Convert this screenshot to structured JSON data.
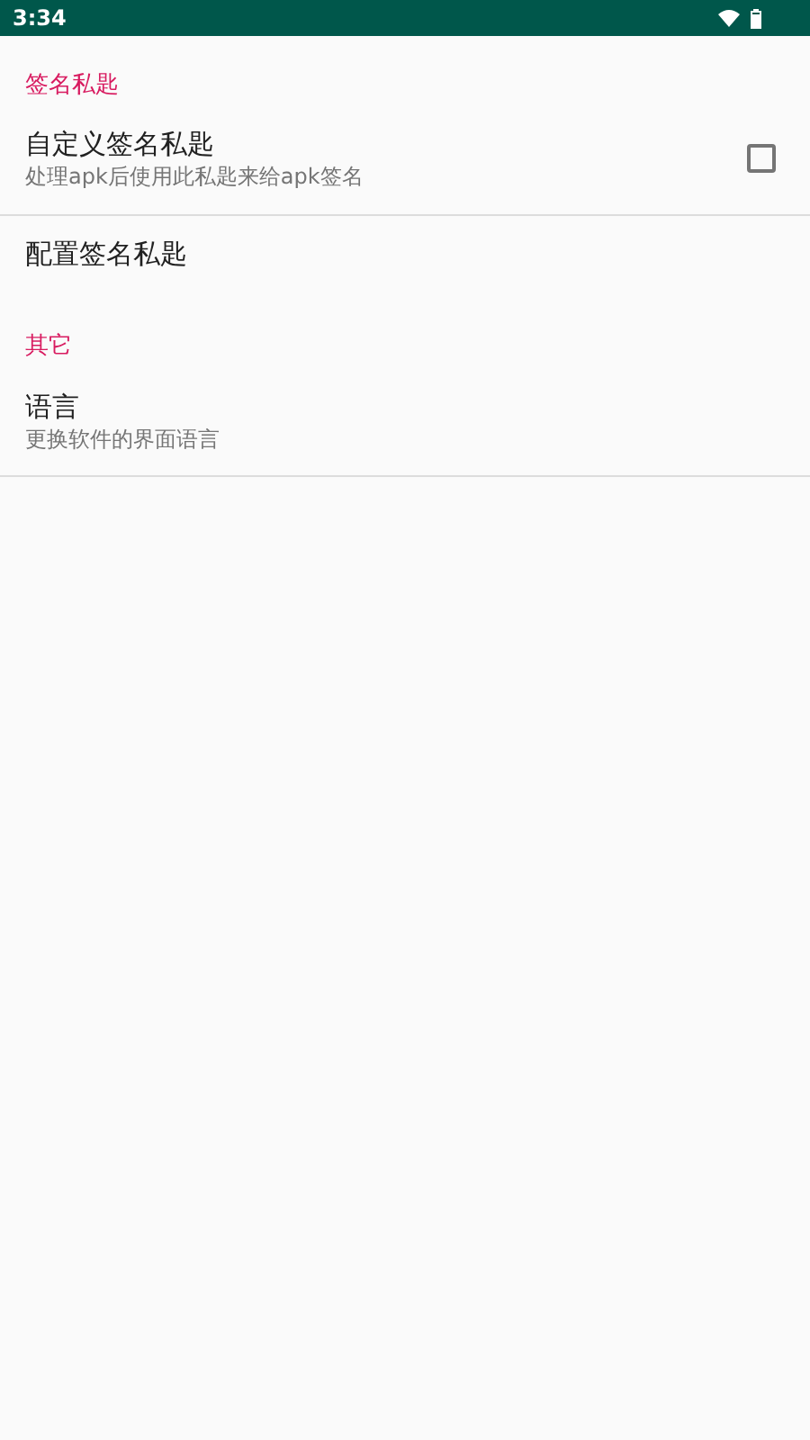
{
  "status_bar": {
    "time": "3:34"
  },
  "sections": [
    {
      "title": "签名私匙",
      "items": [
        {
          "kind": "checkbox",
          "title": "自定义签名私匙",
          "summary": "处理apk后使用此私匙来给apk签名",
          "checked": false,
          "divider": true
        },
        {
          "kind": "plain",
          "title": "配置签名私匙",
          "divider": false
        }
      ]
    },
    {
      "title": "其它",
      "items": [
        {
          "kind": "plain",
          "title": "语言",
          "summary": "更换软件的界面语言",
          "divider": true
        }
      ]
    }
  ]
}
